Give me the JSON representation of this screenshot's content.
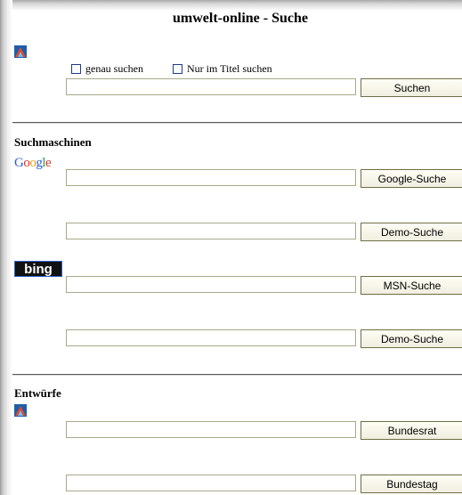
{
  "page": {
    "title": "umwelt-online - Suche"
  },
  "icons": {
    "logo_top": "triangle-logo-icon",
    "logo_mid": "triangle-logo-icon"
  },
  "search": {
    "options": [
      {
        "label": "genau suchen",
        "checked": false
      },
      {
        "label": "Nur im Titel suchen",
        "checked": false
      }
    ],
    "input_value": "",
    "button_label": "Suchen"
  },
  "engines": {
    "heading": "Suchmaschinen",
    "google": {
      "logo_text": "Google",
      "input_value": "",
      "button_label": "Google-Suche",
      "demo_label": "Demo-Suche"
    },
    "bing": {
      "logo_text": "bing",
      "input_value": "",
      "button_label": "MSN-Suche",
      "demo_label": "Demo-Suche"
    }
  },
  "drafts": {
    "heading": "Entwürfe",
    "items": [
      {
        "button_label": "Bundesrat",
        "input_value": ""
      },
      {
        "button_label": "Bundestag",
        "input_value": ""
      }
    ]
  },
  "colors": {
    "rule": "#5b5b5b",
    "button_border": "#6f6f45",
    "field_border": "#a7a98a",
    "checkbox_border": "#233a8a"
  }
}
